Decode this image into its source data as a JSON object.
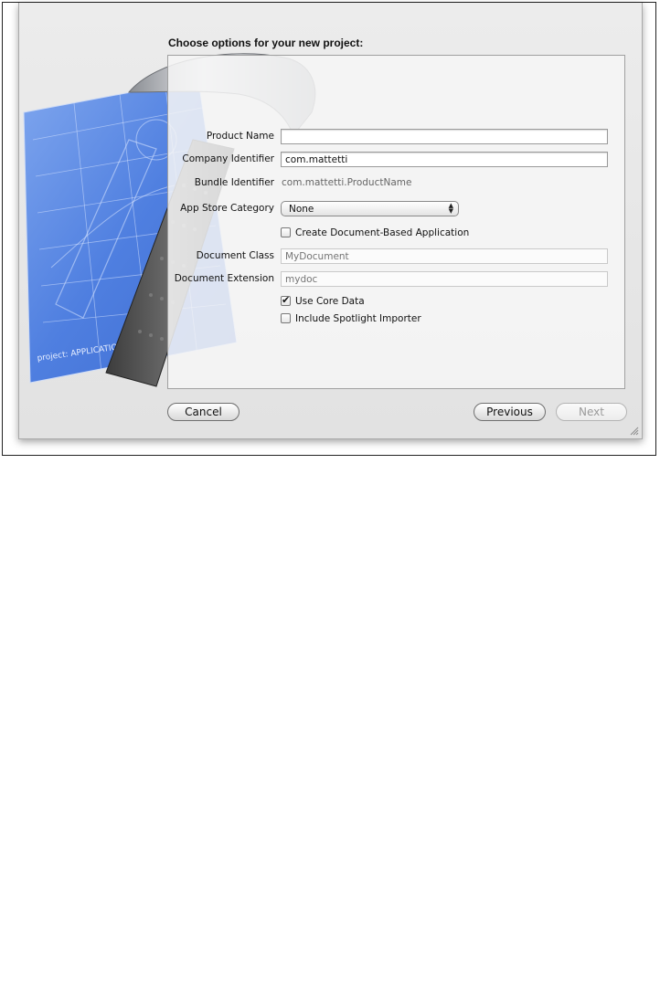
{
  "dialog": {
    "title": "Choose options for your new project:",
    "blueprint_text": "project: APPLICATION.APP"
  },
  "form": {
    "product_name": {
      "label": "Product Name",
      "value": ""
    },
    "company_identifier": {
      "label": "Company Identifier",
      "value": "com.mattetti"
    },
    "bundle_identifier": {
      "label": "Bundle Identifier",
      "value": "com.mattetti.ProductName"
    },
    "app_store_category": {
      "label": "App Store Category",
      "selected": "None"
    },
    "document_based": {
      "label": "Create Document-Based Application",
      "checked": false
    },
    "document_class": {
      "label": "Document Class",
      "placeholder": "MyDocument"
    },
    "document_extension": {
      "label": "Document Extension",
      "placeholder": "mydoc"
    },
    "use_core_data": {
      "label": "Use Core Data",
      "checked": true
    },
    "spotlight_importer": {
      "label": "Include Spotlight Importer",
      "checked": false
    }
  },
  "buttons": {
    "cancel": "Cancel",
    "previous": "Previous",
    "next": "Next"
  }
}
